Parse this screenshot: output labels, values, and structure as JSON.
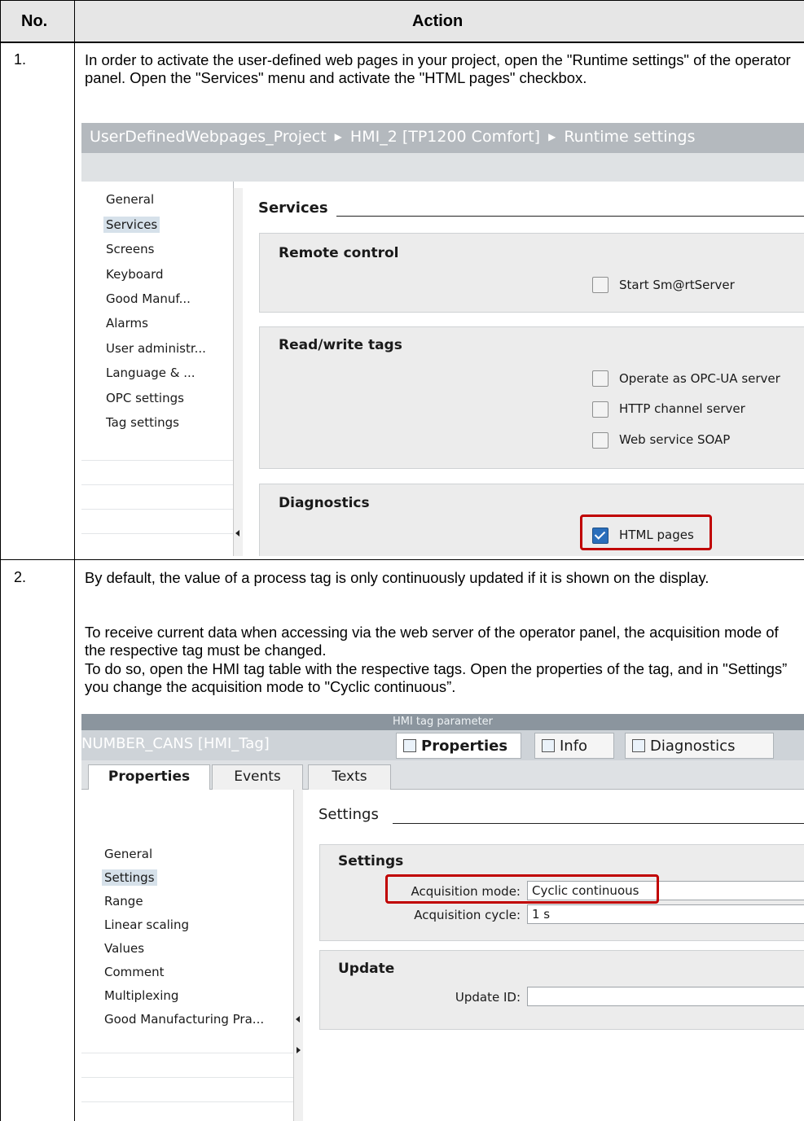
{
  "header": {
    "no_label": "No.",
    "action_label": "Action"
  },
  "step1": {
    "number": "1.",
    "text": "In order to activate the user-defined web pages in your project, open the \"Runtime settings\" of the operator panel. Open the \"Services\" menu and activate the \"HTML pages\" checkbox.",
    "breadcrumb": [
      "UserDefinedWebpages_Project",
      "HMI_2 [TP1200 Comfort]",
      "Runtime settings"
    ],
    "nav_items": [
      "General",
      "Services",
      "Screens",
      "Keyboard",
      "Good Manuf...",
      "Alarms",
      "User administr...",
      "Language & ...",
      "OPC settings",
      "Tag settings"
    ],
    "selected_nav": "Services",
    "section_title": "Services",
    "groups": {
      "remote_control": {
        "title": "Remote control",
        "options": [
          {
            "label": "Start Sm@rtServer",
            "checked": false
          }
        ]
      },
      "read_write_tags": {
        "title": "Read/write tags",
        "options": [
          {
            "label": "Operate as OPC-UA server",
            "checked": false
          },
          {
            "label": "HTTP channel server",
            "checked": false
          },
          {
            "label": "Web service SOAP",
            "checked": false
          }
        ]
      },
      "diagnostics": {
        "title": "Diagnostics",
        "options": [
          {
            "label": "HTML pages",
            "checked": true
          }
        ]
      }
    },
    "highlight_color": "#c00000"
  },
  "step2": {
    "number": "2.",
    "paragraphs": [
      "By default, the value of a process tag is only continuously updated if it is shown on the display.",
      "To receive current data when accessing via the web server of the operator panel, the acquisition mode of the respective tag must be changed.",
      "To do so, open the HMI tag table with the respective tags. Open the properties of the tag, and in \"Settings” you change the acquisition mode to \"Cyclic continuous”."
    ],
    "window_title": "HMI tag parameter",
    "object_title": "NUMBER_CANS [HMI_Tag]",
    "inspector_tabs": [
      "Properties",
      "Info",
      "Diagnostics"
    ],
    "sub_tabs": [
      "Properties",
      "Events",
      "Texts"
    ],
    "nav_items": [
      "General",
      "Settings",
      "Range",
      "Linear scaling",
      "Values",
      "Comment",
      "Multiplexing",
      "Good Manufacturing Pra..."
    ],
    "selected_nav": "Settings",
    "section_title": "Settings",
    "settings_group": {
      "title": "Settings",
      "acquisition_mode_label": "Acquisition mode:",
      "acquisition_mode_value": "Cyclic continuous",
      "acquisition_cycle_label": "Acquisition cycle:",
      "acquisition_cycle_value": "1 s"
    },
    "update_group": {
      "title": "Update",
      "update_id_label": "Update ID:",
      "update_id_value": ""
    }
  }
}
